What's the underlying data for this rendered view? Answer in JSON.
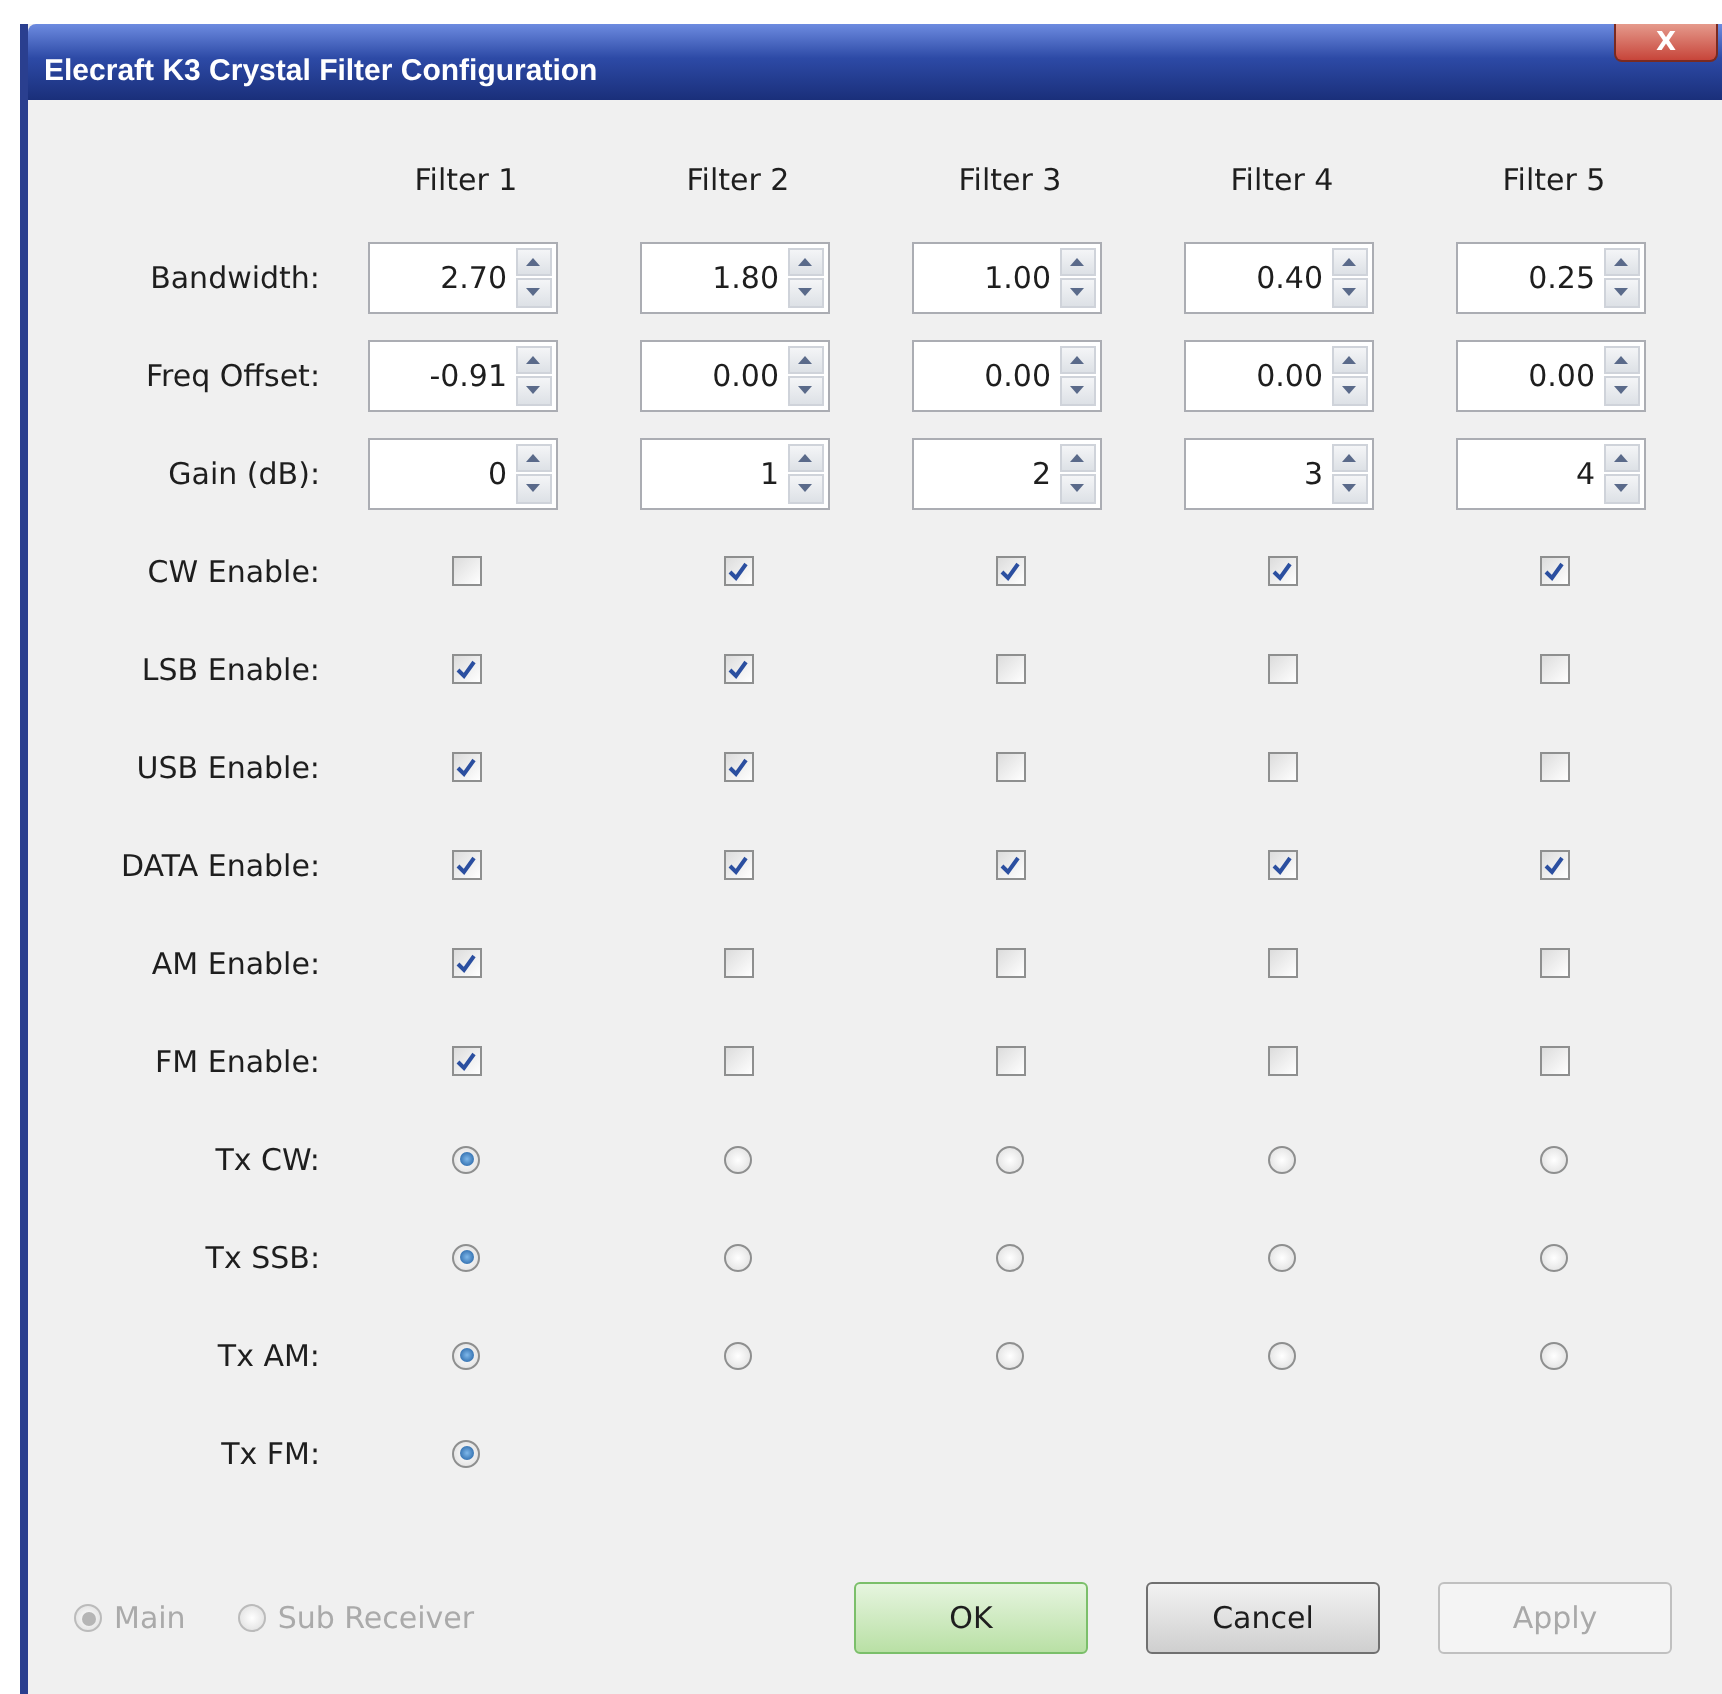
{
  "window": {
    "title": "Elecraft K3 Crystal Filter Configuration",
    "close": "X"
  },
  "filters": [
    "Filter 1",
    "Filter 2",
    "Filter 3",
    "Filter 4",
    "Filter 5"
  ],
  "rows": [
    {
      "label": "Bandwidth:",
      "kind": "spinner",
      "cells": [
        {
          "value": "2.70"
        },
        {
          "value": "1.80"
        },
        {
          "value": "1.00"
        },
        {
          "value": "0.40"
        },
        {
          "value": "0.25"
        }
      ]
    },
    {
      "label": "Freq Offset:",
      "kind": "spinner",
      "cells": [
        {
          "value": "-0.91"
        },
        {
          "value": "0.00"
        },
        {
          "value": "0.00"
        },
        {
          "value": "0.00"
        },
        {
          "value": "0.00"
        }
      ]
    },
    {
      "label": "Gain (dB):",
      "kind": "spinner",
      "cells": [
        {
          "value": "0"
        },
        {
          "value": "1"
        },
        {
          "value": "2"
        },
        {
          "value": "3"
        },
        {
          "value": "4"
        }
      ]
    },
    {
      "label": "CW Enable:",
      "kind": "checkbox",
      "cells": [
        {
          "checked": false
        },
        {
          "checked": true
        },
        {
          "checked": true
        },
        {
          "checked": true
        },
        {
          "checked": true
        }
      ]
    },
    {
      "label": "LSB Enable:",
      "kind": "checkbox",
      "cells": [
        {
          "checked": true
        },
        {
          "checked": true
        },
        {
          "checked": false
        },
        {
          "checked": false
        },
        {
          "checked": false
        }
      ]
    },
    {
      "label": "USB Enable:",
      "kind": "checkbox",
      "cells": [
        {
          "checked": true
        },
        {
          "checked": true
        },
        {
          "checked": false
        },
        {
          "checked": false
        },
        {
          "checked": false
        }
      ]
    },
    {
      "label": "DATA Enable:",
      "kind": "checkbox",
      "cells": [
        {
          "checked": true
        },
        {
          "checked": true
        },
        {
          "checked": true
        },
        {
          "checked": true
        },
        {
          "checked": true
        }
      ]
    },
    {
      "label": "AM Enable:",
      "kind": "checkbox",
      "cells": [
        {
          "checked": true
        },
        {
          "checked": false
        },
        {
          "checked": false
        },
        {
          "checked": false
        },
        {
          "checked": false
        }
      ]
    },
    {
      "label": "FM Enable:",
      "kind": "checkbox",
      "cells": [
        {
          "checked": true
        },
        {
          "checked": false
        },
        {
          "checked": false
        },
        {
          "checked": false
        },
        {
          "checked": false
        }
      ]
    },
    {
      "label": "Tx CW:",
      "kind": "radio",
      "cells": [
        {
          "selected": true
        },
        {
          "selected": false
        },
        {
          "selected": false
        },
        {
          "selected": false
        },
        {
          "selected": false
        }
      ]
    },
    {
      "label": "Tx SSB:",
      "kind": "radio",
      "cells": [
        {
          "selected": true
        },
        {
          "selected": false
        },
        {
          "selected": false
        },
        {
          "selected": false
        },
        {
          "selected": false
        }
      ]
    },
    {
      "label": "Tx AM:",
      "kind": "radio",
      "cells": [
        {
          "selected": true
        },
        {
          "selected": false
        },
        {
          "selected": false
        },
        {
          "selected": false
        },
        {
          "selected": false
        }
      ]
    },
    {
      "label": "Tx FM:",
      "kind": "radio",
      "cells": [
        {
          "selected": true
        }
      ]
    }
  ],
  "receiver": [
    {
      "label": "Main",
      "selected": true,
      "disabled": true
    },
    {
      "label": "Sub Receiver",
      "selected": false,
      "disabled": true
    }
  ],
  "buttons": [
    {
      "label": "OK",
      "default": true,
      "disabled": false
    },
    {
      "label": "Cancel",
      "default": false,
      "disabled": false
    },
    {
      "label": "Apply",
      "default": false,
      "disabled": true
    }
  ]
}
